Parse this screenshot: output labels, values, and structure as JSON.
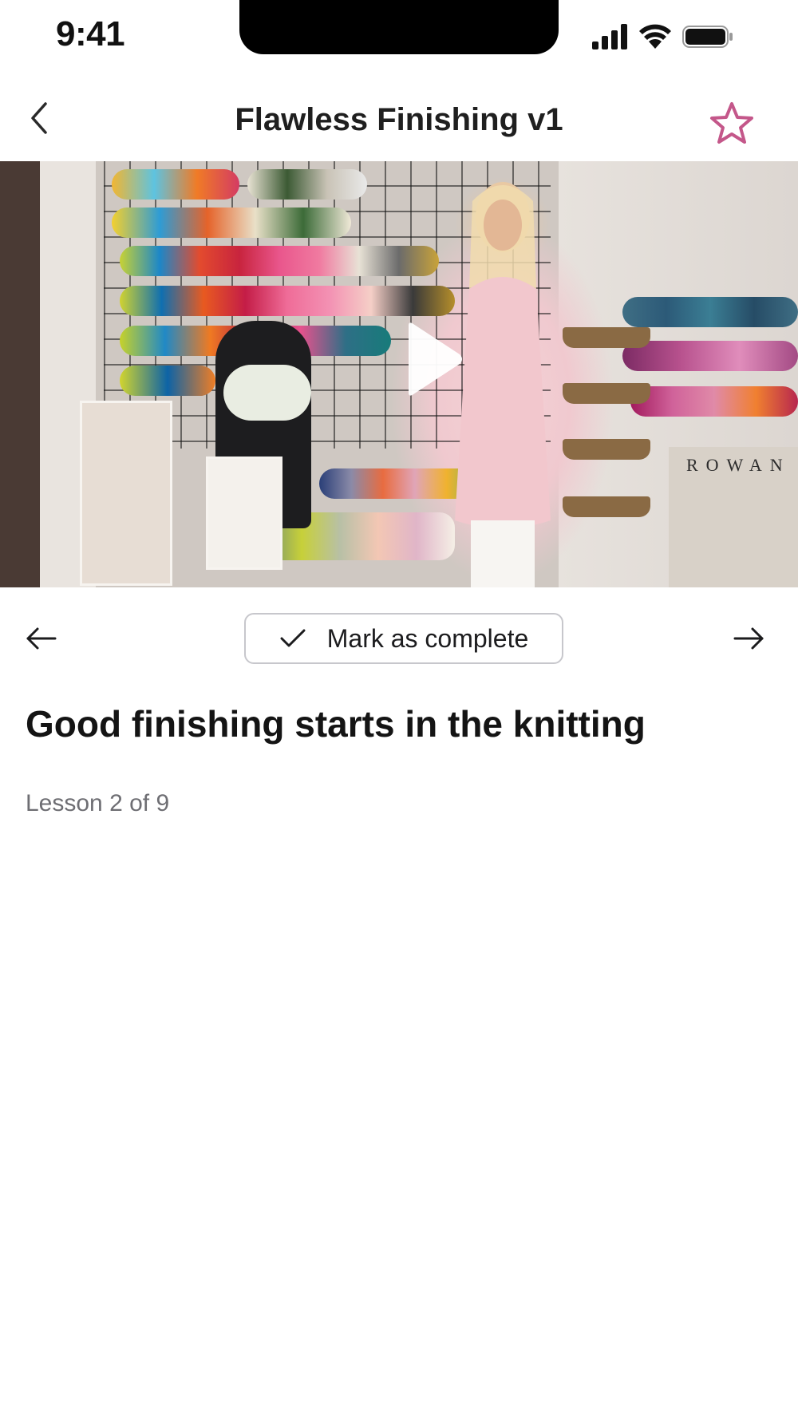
{
  "status_bar": {
    "time": "9:41",
    "icons": [
      "cellular-signal-icon",
      "wifi-icon",
      "battery-icon"
    ]
  },
  "nav": {
    "title": "Flawless Finishing v1",
    "back_icon": "chevron-left-icon",
    "favorite_icon": "star-outline-icon",
    "accent_color": "#c4578a"
  },
  "video": {
    "play_icon": "play-icon",
    "sign_text": "ROWAN"
  },
  "controls": {
    "prev_icon": "arrow-left-icon",
    "next_icon": "arrow-right-icon",
    "complete_icon": "checkmark-icon",
    "complete_label": "Mark as complete"
  },
  "lesson": {
    "title": "Good finishing starts in the knitting",
    "count": "Lesson 2 of 9"
  }
}
